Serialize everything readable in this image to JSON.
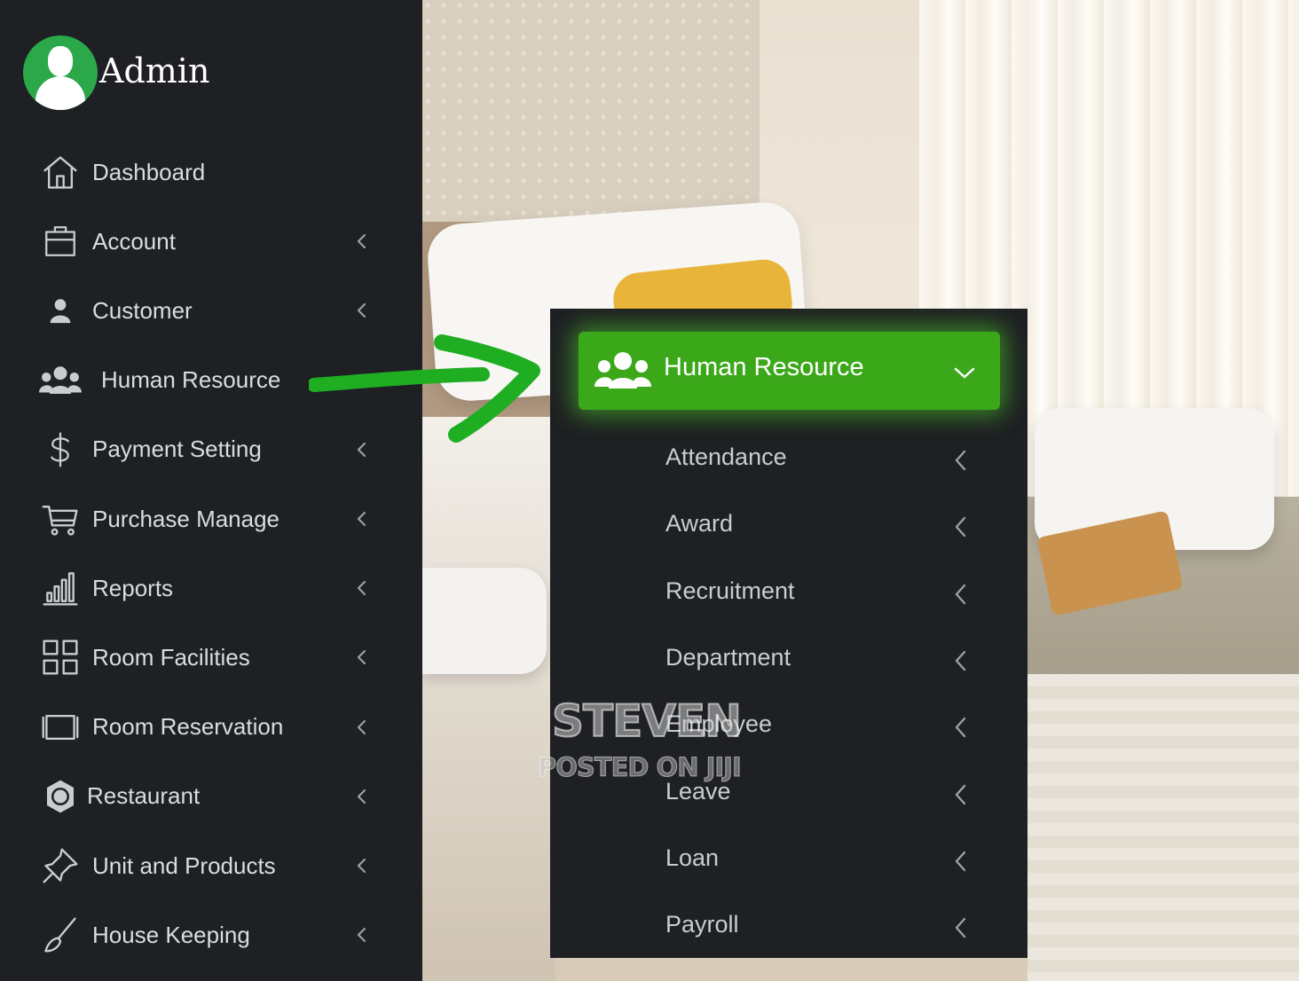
{
  "admin": {
    "name": "Admin",
    "avatar_icon": "user-avatar-icon"
  },
  "colors": {
    "sidebar_bg": "#1e2023",
    "accent_green": "#3ba81a",
    "avatar_green": "#2aa84a",
    "text": "#d9dde2"
  },
  "sidebar": {
    "items": [
      {
        "label": "Dashboard",
        "icon": "home-icon",
        "has_chevron": false
      },
      {
        "label": "Account",
        "icon": "briefcase-icon",
        "has_chevron": true
      },
      {
        "label": "Customer",
        "icon": "user-icon",
        "has_chevron": true
      },
      {
        "label": "Human Resource",
        "icon": "users-icon",
        "has_chevron": false
      },
      {
        "label": "Payment Setting",
        "icon": "dollar-icon",
        "has_chevron": true
      },
      {
        "label": "Purchase Manage",
        "icon": "cart-icon",
        "has_chevron": true
      },
      {
        "label": "Reports",
        "icon": "bar-chart-icon",
        "has_chevron": true
      },
      {
        "label": "Room Facilities",
        "icon": "grid-icon",
        "has_chevron": true
      },
      {
        "label": "Room Reservation",
        "icon": "tablet-icon",
        "has_chevron": true
      },
      {
        "label": "Restaurant",
        "icon": "restaurant-icon",
        "has_chevron": true
      },
      {
        "label": "Unit and Products",
        "icon": "pin-icon",
        "has_chevron": true
      },
      {
        "label": "House Keeping",
        "icon": "broom-icon",
        "has_chevron": true
      }
    ]
  },
  "hr_menu": {
    "title": "Human Resource",
    "icon": "users-icon",
    "expanded": true,
    "items": [
      {
        "label": "Attendance"
      },
      {
        "label": "Award"
      },
      {
        "label": "Recruitment"
      },
      {
        "label": "Department"
      },
      {
        "label": "Employee"
      },
      {
        "label": "Leave"
      },
      {
        "label": "Loan"
      },
      {
        "label": "Payroll"
      }
    ]
  },
  "watermark": {
    "line1": "STEVEN",
    "line2": "POSTED ON JIJI"
  }
}
